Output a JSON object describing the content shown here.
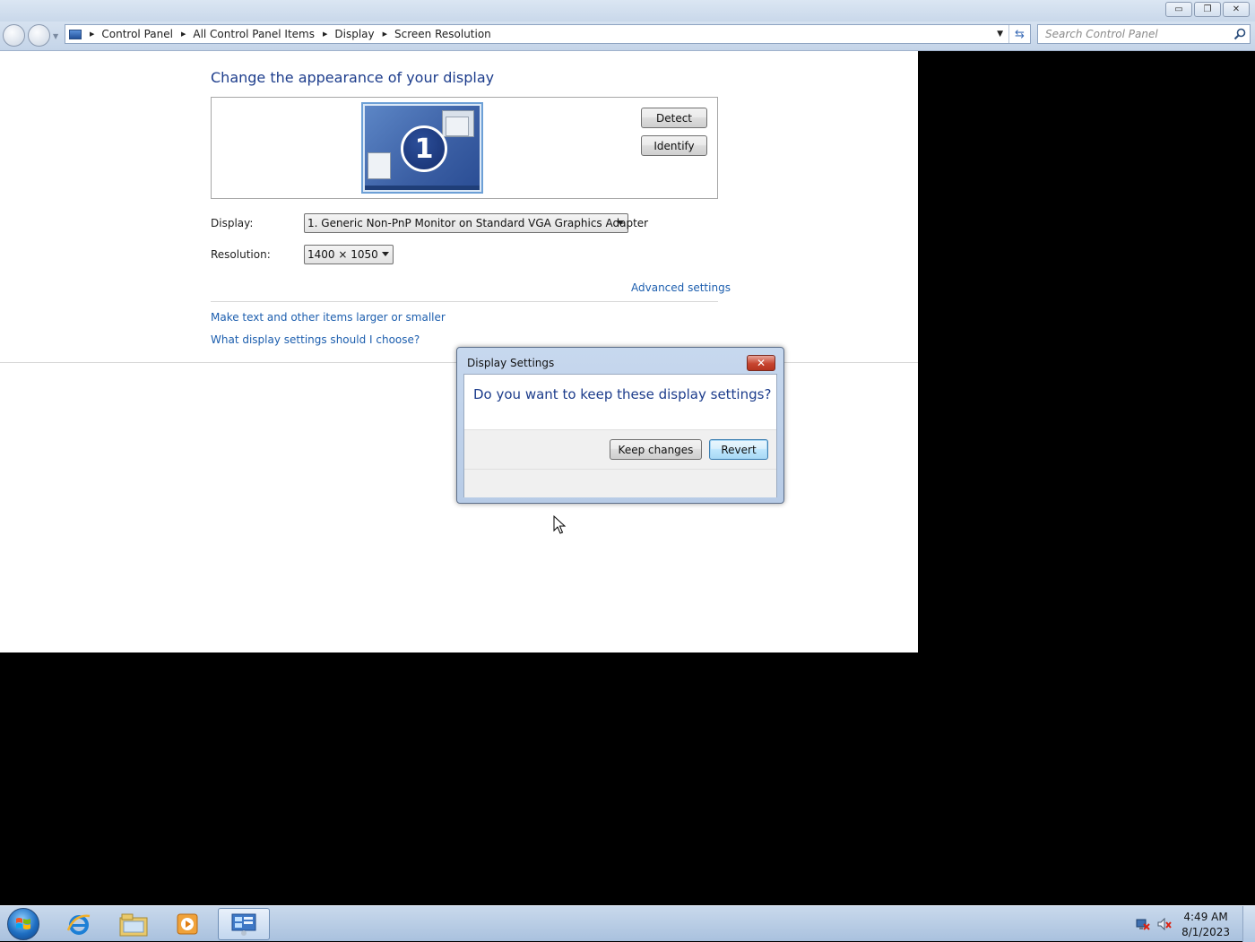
{
  "window": {
    "minimize_glyph": "▭",
    "restore_glyph": "❐",
    "close_glyph": "✕"
  },
  "address": {
    "crumbs": [
      "Control Panel",
      "All Control Panel Items",
      "Display",
      "Screen Resolution"
    ]
  },
  "search": {
    "placeholder": "Search Control Panel"
  },
  "page": {
    "title": "Change the appearance of your display",
    "monitor_number": "1",
    "detect_label": "Detect",
    "identify_label": "Identify",
    "display_label": "Display:",
    "display_value": "1. Generic Non-PnP Monitor on Standard VGA Graphics Adapter",
    "resolution_label": "Resolution:",
    "resolution_value": "1400 × 1050",
    "advanced_link": "Advanced settings",
    "links": [
      "Make text and other items larger or smaller",
      "What display settings should I choose?"
    ]
  },
  "dialog": {
    "title": "Display Settings",
    "close_glyph": "✕",
    "question": "Do you want to keep these display settings?",
    "keep_label": "Keep changes",
    "revert_label": "Revert"
  },
  "taskbar": {
    "items": [
      "start-orb",
      "internet-explorer",
      "windows-explorer",
      "media-player",
      "control-panel"
    ],
    "clock_time": "4:49 AM",
    "clock_date": "8/1/2023"
  },
  "colors": {
    "title_blue": "#1d3d8c",
    "link_blue": "#1c5eae"
  }
}
